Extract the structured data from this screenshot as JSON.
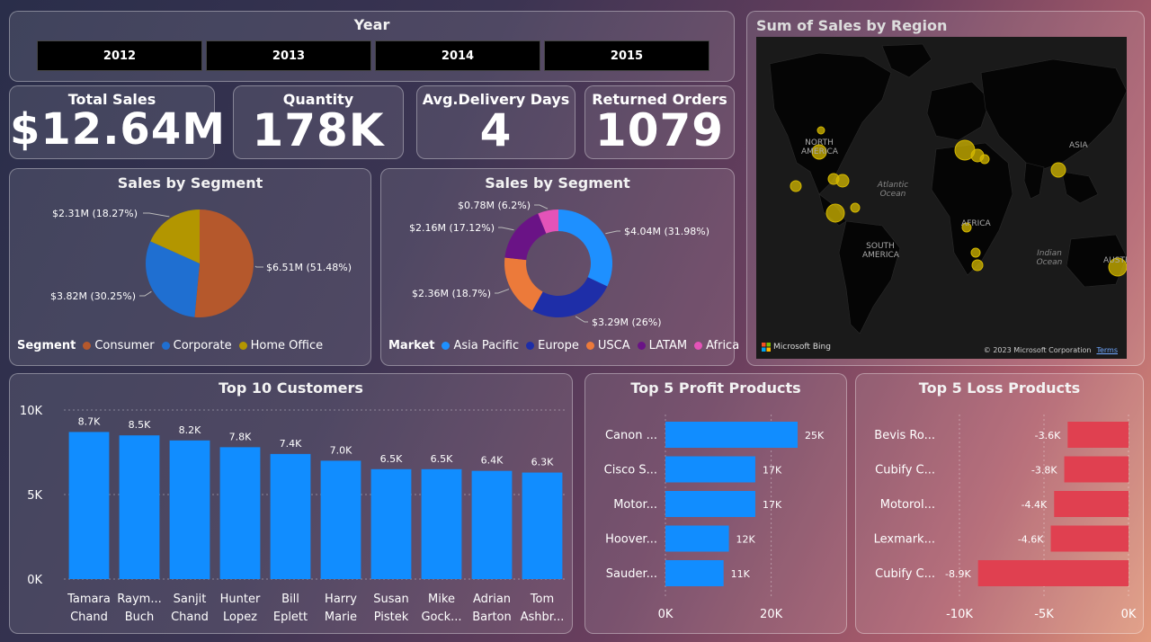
{
  "year_slicer": {
    "title": "Year",
    "options": [
      "2012",
      "2013",
      "2014",
      "2015"
    ]
  },
  "kpis": [
    {
      "label": "Total Sales",
      "value": "$12.64M"
    },
    {
      "label": "Quantity",
      "value": "178K"
    },
    {
      "label": "Avg.Delivery Days",
      "value": "4"
    },
    {
      "label": "Returned Orders",
      "value": "1079"
    }
  ],
  "map": {
    "title": "Sum of Sales by Region",
    "labels": [
      "NORTH AMERICA",
      "SOUTH AMERICA",
      "AFRICA",
      "ASIA",
      "AUSTRA"
    ],
    "oceans": [
      "Atlantic Ocean",
      "Indian Ocean"
    ],
    "bing": "Microsoft Bing",
    "copyright": "© 2023 Microsoft Corporation",
    "terms": "Terms"
  },
  "colors": {
    "consumer": "#b5582c",
    "corporate": "#1f6fd1",
    "home_office": "#b39600",
    "asia_pacific": "#1e90ff",
    "europe": "#1e2ea8",
    "usca": "#ec7a3a",
    "latam": "#6a1386",
    "africa": "#e453b8",
    "bar_blue": "#118dff",
    "loss_red": "#e04050"
  },
  "chart_data": [
    {
      "type": "pie",
      "title": "Sales by Segment",
      "legend_title": "Segment",
      "legend_position": "bottom-left",
      "categories": [
        "Consumer",
        "Corporate",
        "Home Office"
      ],
      "values": [
        6.51,
        3.82,
        2.31
      ],
      "data_labels": [
        "$6.51M (51.48%)",
        "$3.82M (30.25%)",
        "$2.31M (18.27%)"
      ]
    },
    {
      "type": "pie",
      "title": "Sales by Segment",
      "legend_title": "Market",
      "legend_position": "bottom-left",
      "categories": [
        "Asia Pacific",
        "Europe",
        "USCA",
        "LATAM",
        "Africa"
      ],
      "values": [
        4.04,
        3.29,
        2.36,
        2.16,
        0.78
      ],
      "data_labels": [
        "$4.04M (31.98%)",
        "$3.29M (26%)",
        "$2.36M (18.7%)",
        "$2.16M (17.12%)",
        "$0.78M (6.2%)"
      ]
    },
    {
      "type": "bar",
      "title": "Top 10 Customers",
      "categories": [
        [
          "Tamara",
          "Chand"
        ],
        [
          "Raym...",
          "Buch"
        ],
        [
          "Sanjit",
          "Chand"
        ],
        [
          "Hunter",
          "Lopez"
        ],
        [
          "Bill",
          "Eplett"
        ],
        [
          "Harry",
          "Marie"
        ],
        [
          "Susan",
          "Pistek"
        ],
        [
          "Mike",
          "Gock..."
        ],
        [
          "Adrian",
          "Barton"
        ],
        [
          "Tom",
          "Ashbr..."
        ]
      ],
      "values": [
        8700,
        8500,
        8200,
        7800,
        7400,
        7000,
        6500,
        6500,
        6400,
        6300
      ],
      "data_labels": [
        "8.7K",
        "8.5K",
        "8.2K",
        "7.8K",
        "7.4K",
        "7.0K",
        "6.5K",
        "6.5K",
        "6.4K",
        "6.3K"
      ],
      "yticks": [
        "0K",
        "5K",
        "10K"
      ],
      "ylim": [
        0,
        10000
      ]
    },
    {
      "type": "bar",
      "orientation": "horizontal",
      "title": "Top 5 Profit Products",
      "categories": [
        "Canon ...",
        "Cisco S...",
        "Motor...",
        "Hoover...",
        "Sauder..."
      ],
      "values": [
        25000,
        17000,
        17000,
        12000,
        11000
      ],
      "data_labels": [
        "25K",
        "17K",
        "17K",
        "12K",
        "11K"
      ],
      "xticks": [
        "0K",
        "20K"
      ],
      "xlim": [
        0,
        25000
      ]
    },
    {
      "type": "bar",
      "orientation": "horizontal",
      "title": "Top 5 Loss Products",
      "categories": [
        "Bevis Ro...",
        "Cubify C...",
        "Motorol...",
        "Lexmark...",
        "Cubify C..."
      ],
      "values": [
        -3600,
        -3800,
        -4400,
        -4600,
        -8900
      ],
      "data_labels": [
        "-3.6K",
        "-3.8K",
        "-4.4K",
        "-4.6K",
        "-8.9K"
      ],
      "xticks": [
        "-10K",
        "-5K",
        "0K"
      ],
      "xlim": [
        -10000,
        0
      ]
    }
  ]
}
